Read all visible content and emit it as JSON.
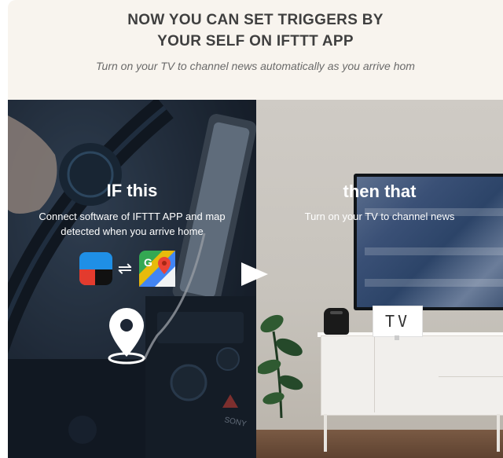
{
  "header": {
    "title_line1": "NOW YOU CAN SET TRIGGERS BY",
    "title_line2": "YOUR SELF ON IFTTT APP",
    "subtitle": "Turn on your TV to channel news automatically as you arrive hom"
  },
  "left_panel": {
    "title": "IF this",
    "desc_line1": "Connect software of IFTTT APP and map",
    "desc_line2": "detected when you arrive home",
    "icons": [
      "ifttt-app-icon",
      "swap-arrows-icon",
      "google-maps-icon",
      "location-pin-icon"
    ]
  },
  "right_panel": {
    "title": "then that",
    "desc": "Turn on your TV to channel news",
    "tv_badge": "TV"
  },
  "colors": {
    "title_text": "#3f3f3f",
    "header_bg": "#f8f4ee",
    "ifttt_blue": "#1f8fe6",
    "ifttt_red": "#e33b2e"
  }
}
